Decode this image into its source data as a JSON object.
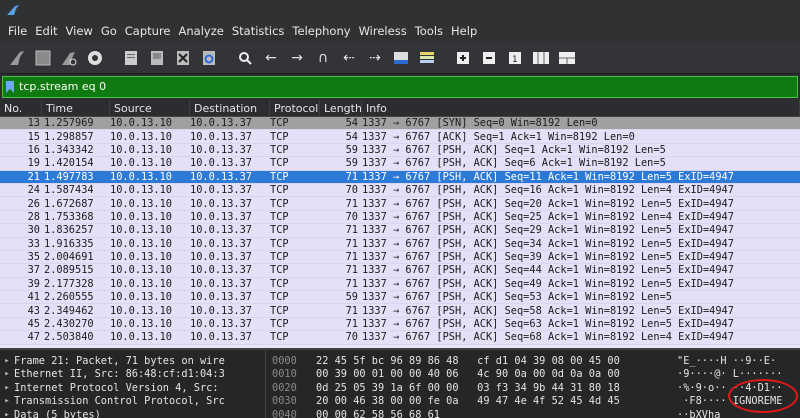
{
  "menu": [
    "File",
    "Edit",
    "View",
    "Go",
    "Capture",
    "Analyze",
    "Statistics",
    "Telephony",
    "Wireless",
    "Tools",
    "Help"
  ],
  "toolbar_icons": [
    "shark-fin-icon",
    "stop-icon",
    "restart-icon",
    "options-gear-icon",
    "open-file-icon",
    "save-file-icon",
    "close-file-icon",
    "reload-icon",
    "find-icon",
    "back-icon",
    "forward-icon",
    "go-to-packet-icon",
    "first-packet-icon",
    "last-packet-icon",
    "autoscroll-icon",
    "colorize-icon",
    "zoom-in-icon",
    "zoom-out-icon",
    "normal-size-icon",
    "resize-columns-icon"
  ],
  "filter": {
    "value": "tcp.stream eq 0"
  },
  "columns": {
    "no": "No.",
    "time": "Time",
    "source": "Source",
    "destination": "Destination",
    "protocol": "Protocol",
    "length": "Length",
    "info": "Info"
  },
  "packets": [
    {
      "no": "13",
      "time": "1.257969",
      "src": "10.0.13.10",
      "dst": "10.0.13.37",
      "proto": "TCP",
      "len": "54",
      "info": "1337 → 6767 [SYN] Seq=0 Win=8192 Len=0",
      "style": "syn"
    },
    {
      "no": "15",
      "time": "1.298857",
      "src": "10.0.13.10",
      "dst": "10.0.13.37",
      "proto": "TCP",
      "len": "54",
      "info": "1337 → 6767 [ACK] Seq=1 Ack=1 Win=8192 Len=0",
      "style": "normal"
    },
    {
      "no": "16",
      "time": "1.343342",
      "src": "10.0.13.10",
      "dst": "10.0.13.37",
      "proto": "TCP",
      "len": "59",
      "info": "1337 → 6767 [PSH, ACK] Seq=1 Ack=1 Win=8192 Len=5",
      "style": "normal"
    },
    {
      "no": "19",
      "time": "1.420154",
      "src": "10.0.13.10",
      "dst": "10.0.13.37",
      "proto": "TCP",
      "len": "59",
      "info": "1337 → 6767 [PSH, ACK] Seq=6 Ack=1 Win=8192 Len=5",
      "style": "normal"
    },
    {
      "no": "21",
      "time": "1.497783",
      "src": "10.0.13.10",
      "dst": "10.0.13.37",
      "proto": "TCP",
      "len": "71",
      "info": "1337 → 6767 [PSH, ACK] Seq=11 Ack=1 Win=8192 Len=5 ExID=4947",
      "style": "selected"
    },
    {
      "no": "24",
      "time": "1.587434",
      "src": "10.0.13.10",
      "dst": "10.0.13.37",
      "proto": "TCP",
      "len": "70",
      "info": "1337 → 6767 [PSH, ACK] Seq=16 Ack=1 Win=8192 Len=4 ExID=4947",
      "style": "normal"
    },
    {
      "no": "26",
      "time": "1.672687",
      "src": "10.0.13.10",
      "dst": "10.0.13.37",
      "proto": "TCP",
      "len": "71",
      "info": "1337 → 6767 [PSH, ACK] Seq=20 Ack=1 Win=8192 Len=5 ExID=4947",
      "style": "normal"
    },
    {
      "no": "28",
      "time": "1.753368",
      "src": "10.0.13.10",
      "dst": "10.0.13.37",
      "proto": "TCP",
      "len": "70",
      "info": "1337 → 6767 [PSH, ACK] Seq=25 Ack=1 Win=8192 Len=4 ExID=4947",
      "style": "normal"
    },
    {
      "no": "30",
      "time": "1.836257",
      "src": "10.0.13.10",
      "dst": "10.0.13.37",
      "proto": "TCP",
      "len": "71",
      "info": "1337 → 6767 [PSH, ACK] Seq=29 Ack=1 Win=8192 Len=5 ExID=4947",
      "style": "normal"
    },
    {
      "no": "33",
      "time": "1.916335",
      "src": "10.0.13.10",
      "dst": "10.0.13.37",
      "proto": "TCP",
      "len": "71",
      "info": "1337 → 6767 [PSH, ACK] Seq=34 Ack=1 Win=8192 Len=5 ExID=4947",
      "style": "normal"
    },
    {
      "no": "35",
      "time": "2.004691",
      "src": "10.0.13.10",
      "dst": "10.0.13.37",
      "proto": "TCP",
      "len": "71",
      "info": "1337 → 6767 [PSH, ACK] Seq=39 Ack=1 Win=8192 Len=5 ExID=4947",
      "style": "normal"
    },
    {
      "no": "37",
      "time": "2.089515",
      "src": "10.0.13.10",
      "dst": "10.0.13.37",
      "proto": "TCP",
      "len": "71",
      "info": "1337 → 6767 [PSH, ACK] Seq=44 Ack=1 Win=8192 Len=5 ExID=4947",
      "style": "normal"
    },
    {
      "no": "39",
      "time": "2.177328",
      "src": "10.0.13.10",
      "dst": "10.0.13.37",
      "proto": "TCP",
      "len": "71",
      "info": "1337 → 6767 [PSH, ACK] Seq=49 Ack=1 Win=8192 Len=5 ExID=4947",
      "style": "normal"
    },
    {
      "no": "41",
      "time": "2.260555",
      "src": "10.0.13.10",
      "dst": "10.0.13.37",
      "proto": "TCP",
      "len": "59",
      "info": "1337 → 6767 [PSH, ACK] Seq=53 Ack=1 Win=8192 Len=5",
      "style": "normal"
    },
    {
      "no": "43",
      "time": "2.349462",
      "src": "10.0.13.10",
      "dst": "10.0.13.37",
      "proto": "TCP",
      "len": "71",
      "info": "1337 → 6767 [PSH, ACK] Seq=58 Ack=1 Win=8192 Len=5 ExID=4947",
      "style": "normal"
    },
    {
      "no": "45",
      "time": "2.430270",
      "src": "10.0.13.10",
      "dst": "10.0.13.37",
      "proto": "TCP",
      "len": "71",
      "info": "1337 → 6767 [PSH, ACK] Seq=63 Ack=1 Win=8192 Len=5 ExID=4947",
      "style": "normal"
    },
    {
      "no": "47",
      "time": "2.503840",
      "src": "10.0.13.10",
      "dst": "10.0.13.37",
      "proto": "TCP",
      "len": "70",
      "info": "1337 → 6767 [PSH, ACK] Seq=68 Ack=1 Win=8192 Len=4 ExID=4947",
      "style": "normal"
    }
  ],
  "details": [
    "Frame 21: Packet, 71 bytes on wire",
    "Ethernet II, Src: 86:48:cf:d1:04:3",
    "Internet Protocol Version 4, Src:",
    "Transmission Control Protocol, Src",
    "Data (5 bytes)"
  ],
  "hex": [
    {
      "off": "0000",
      "bytes": "22 45 5f bc 96 89 86 48   cf d1 04 39 08 00 45 00",
      "ascii": "\"E_····H ··9··E·"
    },
    {
      "off": "0010",
      "bytes": "00 39 00 01 00 00 40 06   4c 90 0a 00 0d 0a 0a 00",
      "ascii": "·9····@· L·······"
    },
    {
      "off": "0020",
      "bytes": "0d 25 05 39 1a 6f 00 00   03 f3 34 9b 44 31 80 18",
      "ascii": "·%·9·o·· ··4·D1··"
    },
    {
      "off": "0030",
      "bytes": "20 00 46 38 00 00 fe 0a   49 47 4e 4f 52 45 4d 45",
      "ascii": " ·F8···· IGNOREME"
    },
    {
      "off": "0040",
      "bytes": "00 00 62 58 56 68 61",
      "ascii": "··bXVha"
    }
  ]
}
